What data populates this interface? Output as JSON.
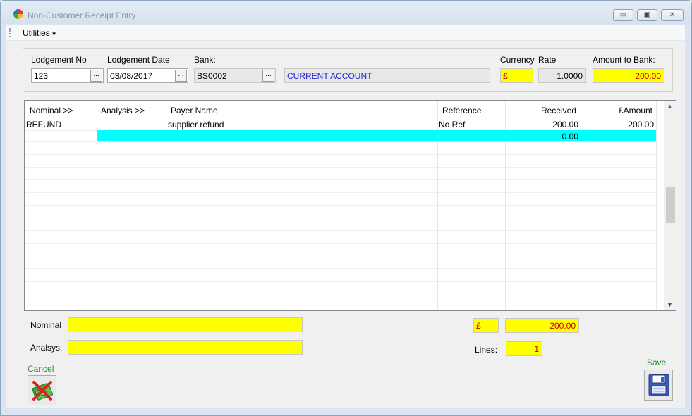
{
  "window": {
    "title": "Non-Customer Receipt Entry",
    "buttons": {
      "minimize": "▭",
      "maximize": "▣",
      "close": "✕"
    }
  },
  "menu": {
    "utilities": "Utilities"
  },
  "header": {
    "lodgement_no_label": "Lodgement No",
    "lodgement_no_value": "123",
    "lodgement_date_label": "Lodgement Date",
    "lodgement_date_value": "03/08/2017",
    "bank_label": "Bank:",
    "bank_code": "BS0002",
    "bank_name": "CURRENT ACCOUNT",
    "currency_label": "Currency",
    "currency_value": "£",
    "rate_label": "Rate",
    "rate_value": "1.0000",
    "amount_label": "Amount to Bank:",
    "amount_value": "200.00",
    "ellipsis": "..."
  },
  "grid": {
    "columns": [
      "Nominal >>",
      "Analysis >>",
      "Payer Name",
      "Reference",
      "Received",
      "£Amount"
    ],
    "rows": [
      {
        "nominal": "REFUND",
        "analysis": "",
        "payer": "supplier refund",
        "reference": "No Ref",
        "received": "200.00",
        "amount": "200.00"
      },
      {
        "nominal": "",
        "analysis": "",
        "payer": "",
        "reference": "",
        "received": "0.00",
        "amount": ""
      }
    ]
  },
  "footer": {
    "nominal_label": "Nominal",
    "nominal_value": "",
    "analysis_label": "Analsys:",
    "analysis_value": "",
    "currency_value": "£",
    "total_value": "200.00",
    "lines_label": "Lines:",
    "lines_value": "1",
    "cancel_label": "Cancel",
    "save_label": "Save"
  },
  "colors": {
    "highlight_yellow": "#ffff00",
    "active_row": "#00ffff",
    "amount_text": "#cc0000",
    "bank_name_text": "#1f1fd6",
    "button_label": "#2a8a2a"
  }
}
